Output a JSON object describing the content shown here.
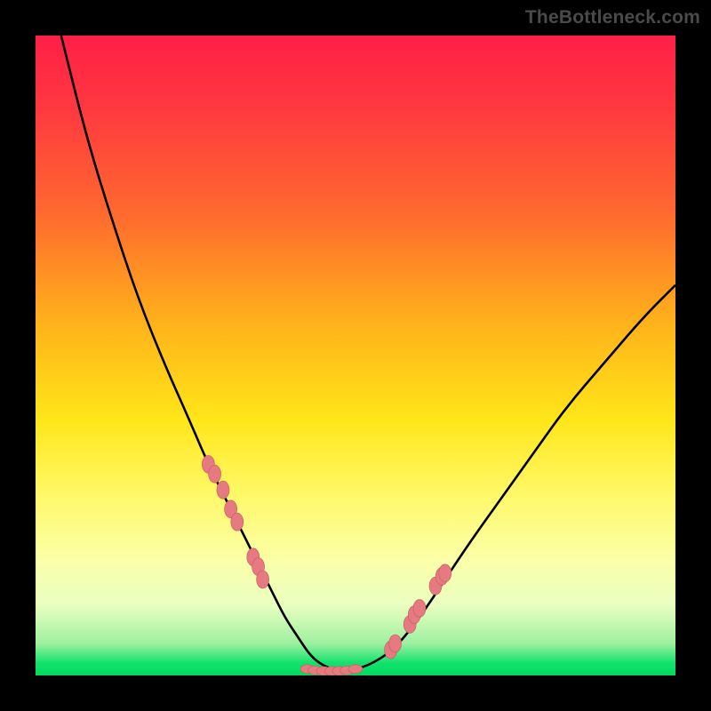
{
  "watermark": "TheBottleneck.com",
  "colors": {
    "curve": "#000000",
    "marker_fill": "#e57b80",
    "marker_stroke": "#c9565d",
    "gradient_top": "#ff1f47",
    "gradient_bottom": "#03d95f"
  },
  "chart_data": {
    "type": "line",
    "title": "",
    "xlabel": "",
    "ylabel": "",
    "xlim": [
      0,
      100
    ],
    "ylim": [
      0,
      100
    ],
    "grid": false,
    "legend": false,
    "series": [
      {
        "name": "bottleneck-curve",
        "x": [
          4,
          8,
          12,
          16,
          20,
          24,
          27,
          30,
          33,
          35,
          37,
          39,
          41,
          43,
          45,
          47,
          49,
          52,
          56,
          60,
          64,
          68,
          73,
          78,
          83,
          89,
          95,
          100
        ],
        "y": [
          100,
          84,
          71,
          59,
          49,
          40,
          33,
          27,
          21,
          17,
          13,
          9,
          6,
          3,
          1.5,
          0.8,
          0.8,
          1.5,
          4,
          9,
          15,
          21,
          28,
          35,
          42,
          49,
          56,
          61
        ]
      }
    ],
    "markers": {
      "left_cluster": {
        "x": [
          27,
          28,
          29.3,
          30.5,
          31.5,
          34,
          34.8,
          35.5
        ],
        "y": [
          33,
          31.5,
          29,
          26,
          24,
          18.5,
          17,
          15
        ]
      },
      "right_cluster": {
        "x": [
          55.5,
          56.2,
          58.5,
          59.2,
          60,
          62.5,
          63.5,
          64
        ],
        "y": [
          4,
          5,
          8,
          9.5,
          10.5,
          14,
          15.5,
          16
        ]
      },
      "bottom_cluster": {
        "x": [
          42.5,
          43.7,
          45,
          46.3,
          47.5,
          48.7,
          50
        ],
        "y": [
          1,
          0.8,
          0.7,
          0.7,
          0.7,
          0.8,
          1
        ]
      }
    }
  }
}
